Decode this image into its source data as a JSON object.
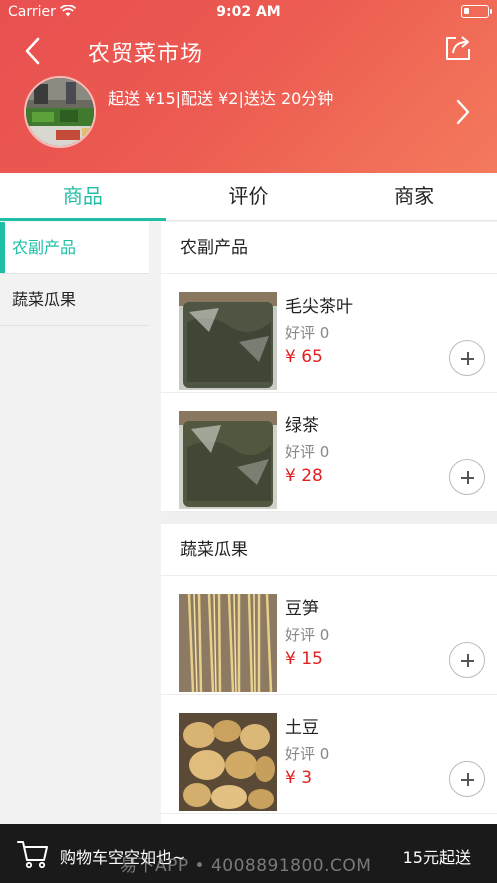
{
  "status_bar": {
    "carrier": "Carrier",
    "time": "9:02 AM"
  },
  "header": {
    "title": "农贸菜市场",
    "shop_info": "起送 ¥15|配送 ¥2|送达 20分钟"
  },
  "tabs": [
    {
      "label": "商品"
    },
    {
      "label": "评价"
    },
    {
      "label": "商家"
    }
  ],
  "sidebar": {
    "items": [
      {
        "label": "农副产品"
      },
      {
        "label": "蔬菜瓜果"
      }
    ]
  },
  "sections": [
    {
      "title": "农副产品",
      "products": [
        {
          "name": "毛尖茶叶",
          "rating": "好评 0",
          "price": "¥ 65"
        },
        {
          "name": "绿茶",
          "rating": "好评 0",
          "price": "¥ 28"
        }
      ]
    },
    {
      "title": "蔬菜瓜果",
      "products": [
        {
          "name": "豆笋",
          "rating": "好评 0",
          "price": "¥ 15"
        },
        {
          "name": "土豆",
          "rating": "好评 0",
          "price": "¥ 3"
        }
      ]
    }
  ],
  "cart": {
    "empty_text": "购物车空空如也~",
    "min_delivery": "15元起送"
  },
  "watermark": "易下APP • 4008891800.COM",
  "colors": {
    "accent": "#1fbfa6",
    "header": "#ec5a51",
    "price": "#e02020"
  }
}
